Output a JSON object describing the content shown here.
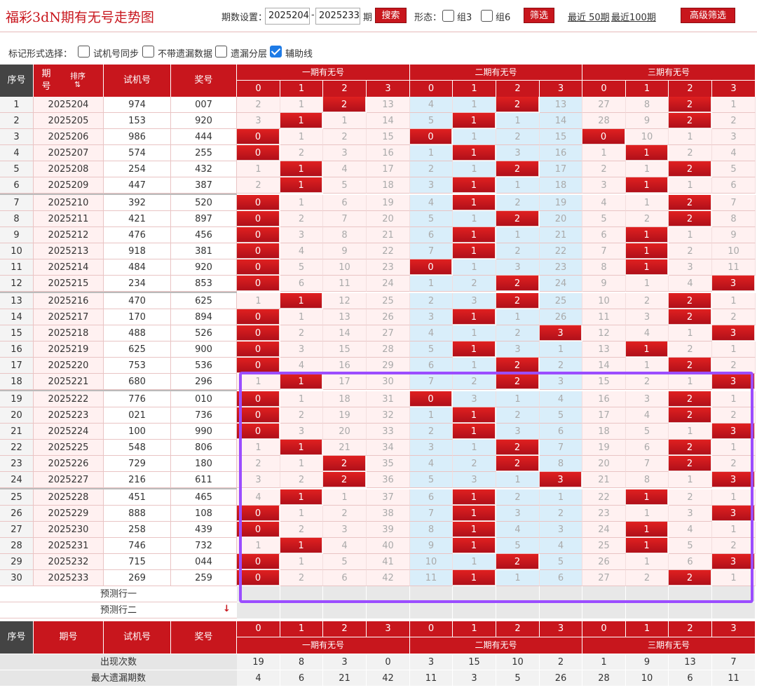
{
  "header": {
    "title": "福彩3dN期有无号走势图",
    "period_label": "期数设置：",
    "period_from": "2025204",
    "period_sep": "-",
    "period_to": "2025233",
    "period_suffix": "期",
    "search_label": "搜索",
    "form_label": "形态：",
    "group3_label": "组3",
    "group6_label": "组6",
    "filter_label": "筛选",
    "recent50": "最近 50期",
    "recent100": "最近100期",
    "advanced_label": "高级筛选"
  },
  "options": {
    "label": "标记形式选择：",
    "items": [
      {
        "label": "试机号同步",
        "checked": false
      },
      {
        "label": "不带遗漏数据",
        "checked": false
      },
      {
        "label": "遗漏分层",
        "checked": false
      },
      {
        "label": "辅助线",
        "checked": true
      }
    ]
  },
  "table": {
    "col_seq": "序号",
    "col_period": "期号",
    "sort_label": "排序",
    "col_trial": "试机号",
    "col_prize": "奖号",
    "groups": [
      "一期有无号",
      "二期有无号",
      "三期有无号"
    ],
    "digits": [
      "0",
      "1",
      "2",
      "3"
    ],
    "rows": [
      [
        "1",
        "2025204",
        "974",
        "007",
        [
          2,
          1,
          "2",
          13
        ],
        [
          4,
          1,
          "2",
          13
        ],
        [
          27,
          8,
          "2",
          1
        ]
      ],
      [
        "2",
        "2025205",
        "153",
        "920",
        [
          3,
          "1",
          1,
          14
        ],
        [
          5,
          "1",
          1,
          14
        ],
        [
          28,
          9,
          "2",
          2
        ]
      ],
      [
        "3",
        "2025206",
        "986",
        "444",
        [
          "0",
          1,
          2,
          15
        ],
        [
          "0",
          1,
          2,
          15
        ],
        [
          "0",
          10,
          1,
          3
        ]
      ],
      [
        "4",
        "2025207",
        "574",
        "255",
        [
          "0",
          2,
          3,
          16
        ],
        [
          1,
          "1",
          3,
          16
        ],
        [
          1,
          "1",
          2,
          4
        ]
      ],
      [
        "5",
        "2025208",
        "254",
        "432",
        [
          1,
          "1",
          4,
          17
        ],
        [
          2,
          1,
          "2",
          17
        ],
        [
          2,
          1,
          "2",
          5
        ]
      ],
      [
        "6",
        "2025209",
        "447",
        "387",
        [
          2,
          "1",
          5,
          18
        ],
        [
          3,
          "1",
          1,
          18
        ],
        [
          3,
          "1",
          1,
          6
        ]
      ],
      [
        "7",
        "2025210",
        "392",
        "520",
        [
          "0",
          1,
          6,
          19
        ],
        [
          4,
          "1",
          2,
          19
        ],
        [
          4,
          1,
          "2",
          7
        ]
      ],
      [
        "8",
        "2025211",
        "421",
        "897",
        [
          "0",
          2,
          7,
          20
        ],
        [
          5,
          1,
          "2",
          20
        ],
        [
          5,
          2,
          "2",
          8
        ]
      ],
      [
        "9",
        "2025212",
        "476",
        "456",
        [
          "0",
          3,
          8,
          21
        ],
        [
          6,
          "1",
          1,
          21
        ],
        [
          6,
          "1",
          1,
          9
        ]
      ],
      [
        "10",
        "2025213",
        "918",
        "381",
        [
          "0",
          4,
          9,
          22
        ],
        [
          7,
          "1",
          2,
          22
        ],
        [
          7,
          "1",
          2,
          10
        ]
      ],
      [
        "11",
        "2025214",
        "484",
        "920",
        [
          "0",
          5,
          10,
          23
        ],
        [
          "0",
          1,
          3,
          23
        ],
        [
          8,
          "1",
          3,
          11
        ]
      ],
      [
        "12",
        "2025215",
        "234",
        "853",
        [
          "0",
          6,
          11,
          24
        ],
        [
          1,
          2,
          "2",
          24
        ],
        [
          9,
          1,
          4,
          "3"
        ]
      ],
      [
        "13",
        "2025216",
        "470",
        "625",
        [
          1,
          "1",
          12,
          25
        ],
        [
          2,
          3,
          "2",
          25
        ],
        [
          10,
          2,
          "2",
          1
        ]
      ],
      [
        "14",
        "2025217",
        "170",
        "894",
        [
          "0",
          1,
          13,
          26
        ],
        [
          3,
          "1",
          1,
          26
        ],
        [
          11,
          3,
          "2",
          2
        ]
      ],
      [
        "15",
        "2025218",
        "488",
        "526",
        [
          "0",
          2,
          14,
          27
        ],
        [
          4,
          1,
          2,
          "3"
        ],
        [
          12,
          4,
          1,
          "3"
        ]
      ],
      [
        "16",
        "2025219",
        "625",
        "900",
        [
          "0",
          3,
          15,
          28
        ],
        [
          5,
          "1",
          3,
          1
        ],
        [
          13,
          "1",
          2,
          1
        ]
      ],
      [
        "17",
        "2025220",
        "753",
        "536",
        [
          "0",
          4,
          16,
          29
        ],
        [
          6,
          1,
          "2",
          2
        ],
        [
          14,
          1,
          "2",
          2
        ]
      ],
      [
        "18",
        "2025221",
        "680",
        "296",
        [
          1,
          "1",
          17,
          30
        ],
        [
          7,
          2,
          "2",
          3
        ],
        [
          15,
          2,
          1,
          "3"
        ]
      ],
      [
        "19",
        "2025222",
        "776",
        "010",
        [
          "0",
          1,
          18,
          31
        ],
        [
          "0",
          3,
          1,
          4
        ],
        [
          16,
          3,
          "2",
          1
        ]
      ],
      [
        "20",
        "2025223",
        "021",
        "736",
        [
          "0",
          2,
          19,
          32
        ],
        [
          1,
          "1",
          2,
          5
        ],
        [
          17,
          4,
          "2",
          2
        ]
      ],
      [
        "21",
        "2025224",
        "100",
        "990",
        [
          "0",
          3,
          20,
          33
        ],
        [
          2,
          "1",
          3,
          6
        ],
        [
          18,
          5,
          1,
          "3"
        ]
      ],
      [
        "22",
        "2025225",
        "548",
        "806",
        [
          1,
          "1",
          21,
          34
        ],
        [
          3,
          1,
          "2",
          7
        ],
        [
          19,
          6,
          "2",
          1
        ]
      ],
      [
        "23",
        "2025226",
        "729",
        "180",
        [
          2,
          1,
          "2",
          35
        ],
        [
          4,
          2,
          "2",
          8
        ],
        [
          20,
          7,
          "2",
          2
        ]
      ],
      [
        "24",
        "2025227",
        "216",
        "611",
        [
          3,
          2,
          "2",
          36
        ],
        [
          5,
          3,
          1,
          "3"
        ],
        [
          21,
          8,
          1,
          "3"
        ]
      ],
      [
        "25",
        "2025228",
        "451",
        "465",
        [
          4,
          "1",
          1,
          37
        ],
        [
          6,
          "1",
          2,
          1
        ],
        [
          22,
          "1",
          2,
          1
        ]
      ],
      [
        "26",
        "2025229",
        "888",
        "108",
        [
          "0",
          1,
          2,
          38
        ],
        [
          7,
          "1",
          3,
          2
        ],
        [
          23,
          1,
          3,
          "3"
        ]
      ],
      [
        "27",
        "2025230",
        "258",
        "439",
        [
          "0",
          2,
          3,
          39
        ],
        [
          8,
          "1",
          4,
          3
        ],
        [
          24,
          "1",
          4,
          1
        ]
      ],
      [
        "28",
        "2025231",
        "746",
        "732",
        [
          1,
          "1",
          4,
          40
        ],
        [
          9,
          "1",
          5,
          4
        ],
        [
          25,
          "1",
          5,
          2
        ]
      ],
      [
        "29",
        "2025232",
        "715",
        "044",
        [
          "0",
          1,
          5,
          41
        ],
        [
          10,
          1,
          "2",
          5
        ],
        [
          26,
          1,
          6,
          "3"
        ]
      ],
      [
        "30",
        "2025233",
        "269",
        "259",
        [
          "0",
          2,
          6,
          42
        ],
        [
          11,
          "1",
          1,
          6
        ],
        [
          27,
          2,
          "2",
          1
        ]
      ]
    ],
    "predict1": "预测行一",
    "predict2": "预测行二",
    "stats": [
      {
        "label": "出现次数",
        "values": [
          19,
          8,
          3,
          0,
          3,
          15,
          10,
          2,
          1,
          9,
          13,
          7
        ]
      },
      {
        "label": "最大遗漏期数",
        "values": [
          4,
          6,
          21,
          42,
          11,
          3,
          5,
          26,
          28,
          10,
          6,
          11
        ]
      }
    ]
  },
  "colors": {
    "red": "#c8161d",
    "panel_blue": "#d9eefa",
    "panel_pink": "#fff1f1",
    "highlight": "#9b4dff"
  }
}
